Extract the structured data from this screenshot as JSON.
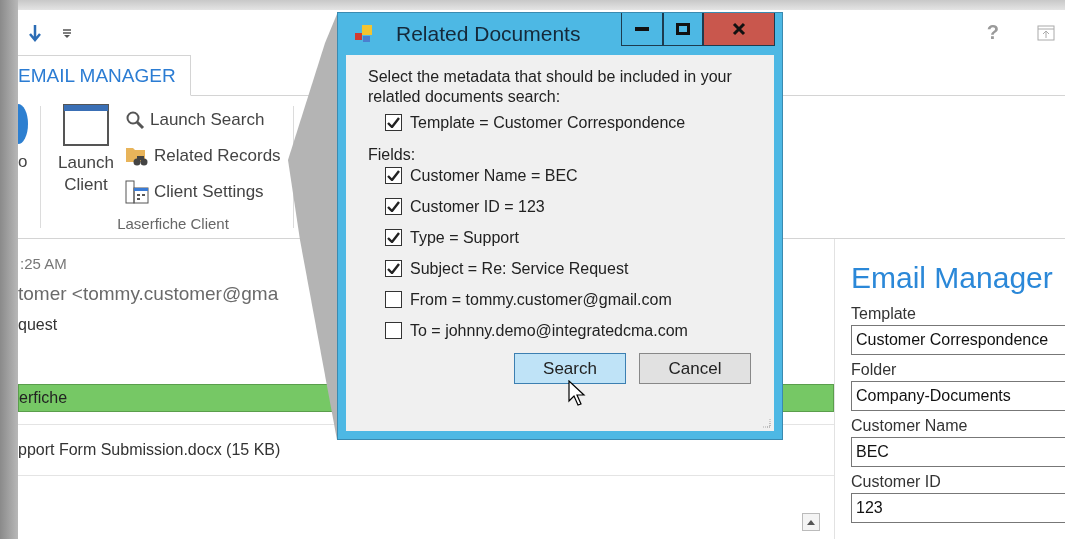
{
  "quick_access": {
    "help": "?"
  },
  "ribbon": {
    "tabs": [
      {
        "label": "EMAIL MANAGER",
        "selected": true
      }
    ],
    "partial_label": "o",
    "group": {
      "label": "Laserfiche Client",
      "large_button": "Launch Client",
      "buttons": [
        {
          "kind": "search",
          "label": "Launch Search"
        },
        {
          "kind": "records",
          "label": "Related Records"
        },
        {
          "kind": "settings",
          "label": "Client Settings"
        }
      ]
    }
  },
  "message": {
    "time": ":25 AM",
    "from": "tomer <tommy.customer@gma",
    "subject": "quest",
    "info_bar": "erfiche",
    "attachment": "pport Form Submission.docx (15 KB)"
  },
  "side_panel": {
    "title": "Email Manager",
    "fields": [
      {
        "label": "Template",
        "value": "Customer Correspondence"
      },
      {
        "label": "Folder",
        "value": "Company-Documents"
      },
      {
        "label": "Customer Name",
        "value": "BEC"
      },
      {
        "label": "Customer ID",
        "value": "123"
      }
    ]
  },
  "dialog": {
    "title": "Related Documents",
    "prompt": "Select the metadata that should be included in your relatled documents search:",
    "template_option": {
      "label": "Template = Customer Correspondence",
      "checked": true
    },
    "fields_label": "Fields:",
    "fields": [
      {
        "label": "Customer Name = BEC",
        "checked": true
      },
      {
        "label": "Customer ID = 123",
        "checked": true
      },
      {
        "label": "Type = Support",
        "checked": true
      },
      {
        "label": "Subject = Re: Service Request",
        "checked": true
      },
      {
        "label": "From = tommy.customer@gmail.com",
        "checked": false
      },
      {
        "label": "To = johnny.demo@integratedcma.com",
        "checked": false
      }
    ],
    "buttons": [
      {
        "label": "Search",
        "hovered": true
      },
      {
        "label": "Cancel",
        "hovered": false
      }
    ]
  }
}
